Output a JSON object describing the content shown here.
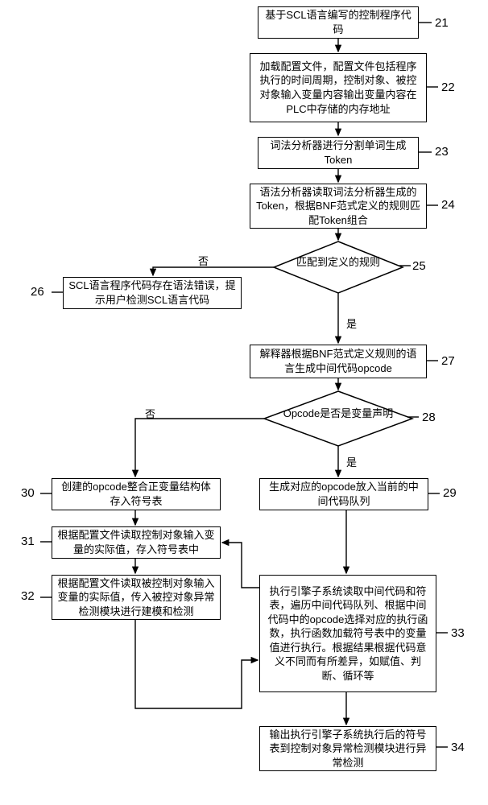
{
  "chart_data": {
    "type": "flowchart",
    "nodes": [
      {
        "id": 21,
        "kind": "process",
        "text": "基于SCL语言编写的控制程序代码"
      },
      {
        "id": 22,
        "kind": "process",
        "text": "加载配置文件，配置文件包括程序执行的时间周期，控制对象、被控对象输入变量内容输出变量内容在PLC中存储的内存地址"
      },
      {
        "id": 23,
        "kind": "process",
        "text": "词法分析器进行分割单词生成Token"
      },
      {
        "id": 24,
        "kind": "process",
        "text": "语法分析器读取词法分析器生成的Token，根据BNF范式定义的规则匹配Token组合"
      },
      {
        "id": 25,
        "kind": "decision",
        "text": "匹配到定义的规则"
      },
      {
        "id": 26,
        "kind": "process",
        "text": "SCL语言程序代码存在语法错误，提示用户检测SCL语言代码"
      },
      {
        "id": 27,
        "kind": "process",
        "text": "解释器根据BNF范式定义规则的语言生成中间代码opcode"
      },
      {
        "id": 28,
        "kind": "decision",
        "text": "Opcode是否是变量声明"
      },
      {
        "id": 29,
        "kind": "process",
        "text": "生成对应的opcode放入当前的中间代码队列"
      },
      {
        "id": 30,
        "kind": "process",
        "text": "创建的opcode整合正变量结构体存入符号表"
      },
      {
        "id": 31,
        "kind": "process",
        "text": "根据配置文件读取控制对象输入变量的实际值，存入符号表中"
      },
      {
        "id": 32,
        "kind": "process",
        "text": "根据配置文件读取被控制对象输入变量的实际值，传入被控对象异常检测模块进行建模和检测"
      },
      {
        "id": 33,
        "kind": "process",
        "text": "执行引擎子系统读取中间代码和符表，遍历中间代码队列、根据中间代码中的opcode选择对应的执行函数，执行函数加载符号表中的变量值进行执行。根据结果根据代码意义不同而有所差异，如赋值、判断、循环等"
      },
      {
        "id": 34,
        "kind": "process",
        "text": "输出执行引擎子系统执行后的符号表到控制对象异常检测模块进行异常检测"
      }
    ],
    "edges": [
      {
        "from": 21,
        "to": 22
      },
      {
        "from": 22,
        "to": 23
      },
      {
        "from": 23,
        "to": 24
      },
      {
        "from": 24,
        "to": 25
      },
      {
        "from": 25,
        "to": 26,
        "label": "否"
      },
      {
        "from": 25,
        "to": 27,
        "label": "是"
      },
      {
        "from": 27,
        "to": 28
      },
      {
        "from": 28,
        "to": 30,
        "label": "否"
      },
      {
        "from": 28,
        "to": 29,
        "label": "是"
      },
      {
        "from": 30,
        "to": 31
      },
      {
        "from": 31,
        "to": 32
      },
      {
        "from": 29,
        "to": 33
      },
      {
        "from": 33,
        "to": 34
      },
      {
        "from": 33,
        "to": 31,
        "note": "feedback-loop"
      },
      {
        "from": 32,
        "to": 33,
        "note": "feedback-loop"
      }
    ],
    "labels": {
      "yes": "是",
      "no": "否"
    }
  },
  "nodes": {
    "n21": "基于SCL语言编写的控制程序代码",
    "n22": "加载配置文件，配置文件包括程序执行的时间周期，控制对象、被控对象输入变量内容输出变量内容在PLC中存储的内存地址",
    "n23": "词法分析器进行分割单词生成Token",
    "n24": "语法分析器读取词法分析器生成的Token，根据BNF范式定义的规则匹配Token组合",
    "n25": "匹配到定义的规则",
    "n26": "SCL语言程序代码存在语法错误，提示用户检测SCL语言代码",
    "n27": "解释器根据BNF范式定义规则的语言生成中间代码opcode",
    "n28": "Opcode是否是变量声明",
    "n29": "生成对应的opcode放入当前的中间代码队列",
    "n30": "创建的opcode整合正变量结构体存入符号表",
    "n31": "根据配置文件读取控制对象输入变量的实际值，存入符号表中",
    "n32": "根据配置文件读取被控制对象输入变量的实际值，传入被控对象异常检测模块进行建模和检测",
    "n33": "执行引擎子系统读取中间代码和符表，遍历中间代码队列、根据中间代码中的opcode选择对应的执行函数，执行函数加载符号表中的变量值进行执行。根据结果根据代码意义不同而有所差异，如赋值、判断、循环等",
    "n34": "输出执行引擎子系统执行后的符号表到控制对象异常检测模块进行异常检测"
  },
  "labels": {
    "no1": "否",
    "yes1": "是",
    "no2": "否",
    "yes2": "是"
  },
  "nums": {
    "n21": "21",
    "n22": "22",
    "n23": "23",
    "n24": "24",
    "n25": "25",
    "n26": "26",
    "n27": "27",
    "n28": "28",
    "n29": "29",
    "n30": "30",
    "n31": "31",
    "n32": "32",
    "n33": "33",
    "n34": "34"
  }
}
